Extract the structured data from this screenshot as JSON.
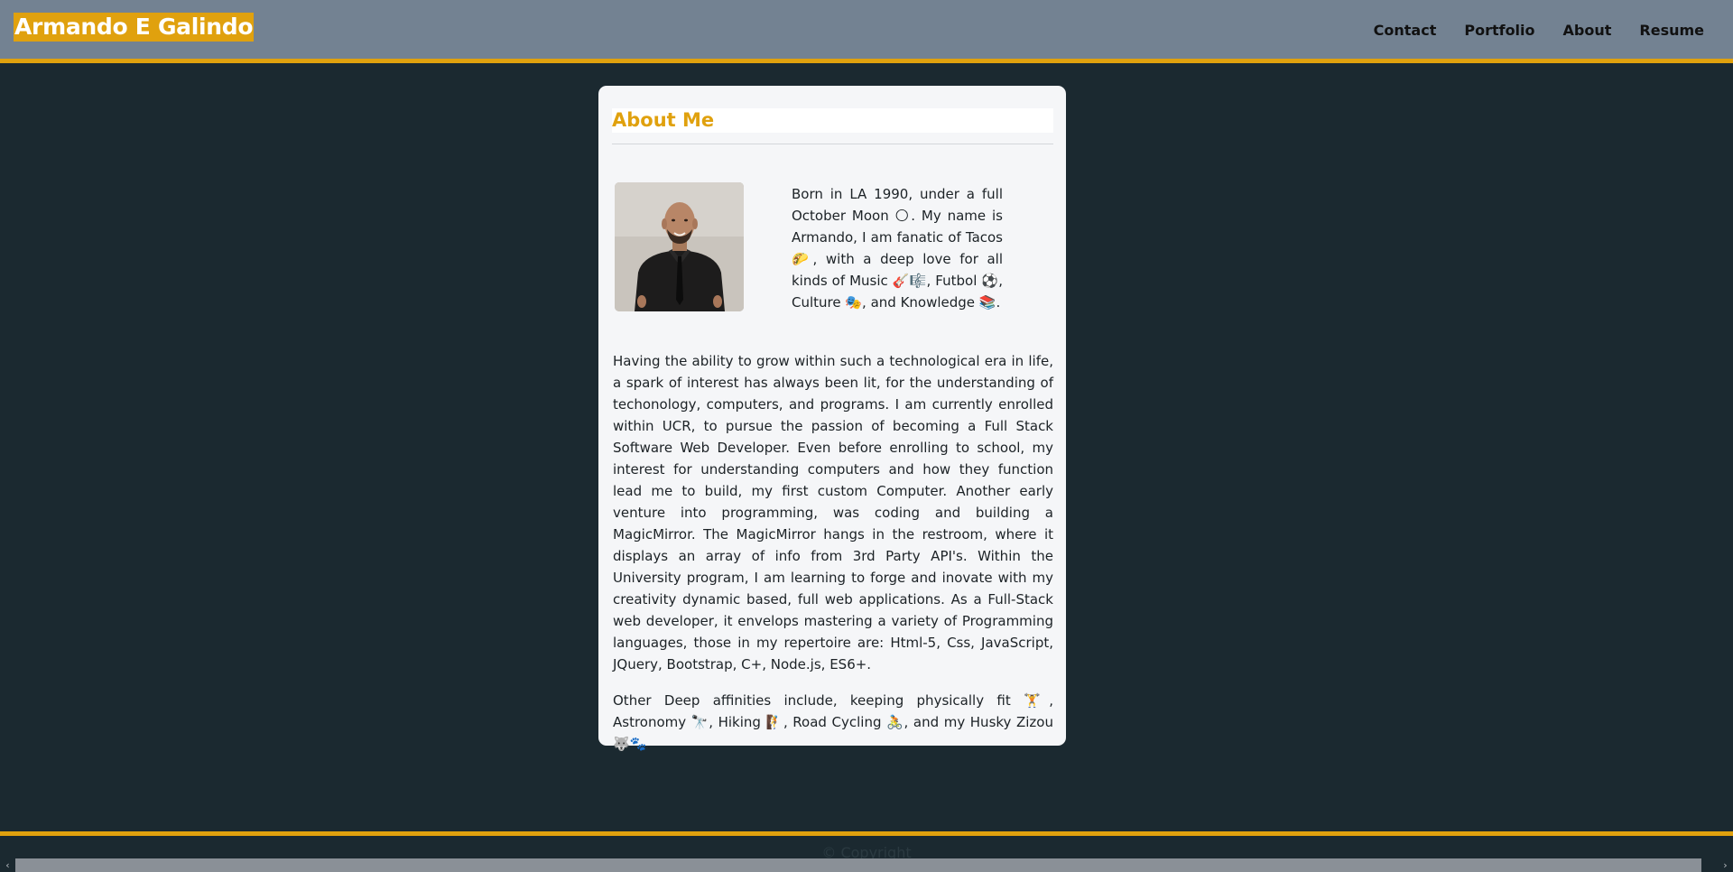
{
  "header": {
    "brand": "Armando E Galindo",
    "nav": [
      "Contact",
      "Portfolio",
      "About",
      "Resume"
    ]
  },
  "about": {
    "title": "About Me",
    "photo_icon": "portrait-photo",
    "intro": "Born in LA 1990, under a full October Moon 🌕. My name is Armando, I am fanatic of Tacos 🌮, with a deep love for all kinds of Music 🎸🎼, Futbol ⚽, Culture 🎭, and Knowledge 📚.",
    "paragraph1": "Having the ability to grow within such a technological era in life, a spark of interest has always been lit, for the understanding of techonology, computers, and programs. I am currently enrolled within UCR, to pursue the passion of becoming a Full Stack Software Web Developer. Even before enrolling to school, my interest for understanding computers and how they function lead me to build, my first custom Computer. Another early venture into programming, was coding and building a MagicMirror. The MagicMirror hangs in the restroom, where it displays an array of info from 3rd Party API's. Within the University program, I am learning to forge and inovate with my creativity dynamic based, full web applications. As a Full-Stack web developer, it envelops mastering a variety of Programming languages, those in my repertoire are: Html-5, Css, JavaScript, JQuery, Bootstrap, C+, Node.js, ES6+.",
    "paragraph2": "Other Deep affinities include, keeping physically fit 🏋, Astronomy 🔭, Hiking 🧗, Road Cycling 🚴, and my Husky Zizou 🐺🐾."
  },
  "footer": {
    "copyright": "© Copyright"
  },
  "scrollbar": {
    "left_arrow": "‹",
    "right_arrow": "›"
  },
  "colors": {
    "accent": "#e0a10e",
    "header_bg": "#738292",
    "page_bg": "#1b2930",
    "card_bg": "#f5f6f8"
  }
}
